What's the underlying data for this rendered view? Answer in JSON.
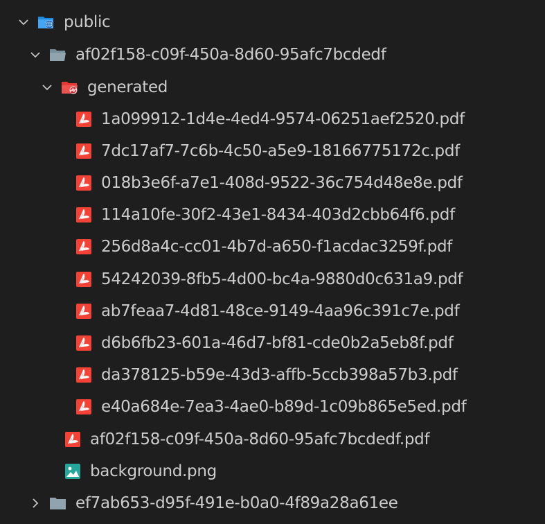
{
  "colors": {
    "background": "#1e1e1e",
    "text": "#cccccc",
    "chevron": "#c5c5c5",
    "folder_public": "#42a5f5",
    "folder_plain": "#90a4ae",
    "folder_generated": "#ef5350",
    "pdf": "#f44336",
    "image": "#26a69a"
  },
  "tree": {
    "public": {
      "label": "public",
      "icon": "folder-public-open-icon",
      "expanded": true
    },
    "folder_af02": {
      "label": "af02f158-c09f-450a-8d60-95afc7bcdedf",
      "icon": "folder-open-icon",
      "expanded": true
    },
    "generated": {
      "label": "generated",
      "icon": "folder-generated-open-icon",
      "expanded": true,
      "files": [
        {
          "label": "1a099912-1d4e-4ed4-9574-06251aef2520.pdf",
          "icon": "pdf-icon"
        },
        {
          "label": "7dc17af7-7c6b-4c50-a5e9-18166775172c.pdf",
          "icon": "pdf-icon"
        },
        {
          "label": "018b3e6f-a7e1-408d-9522-36c754d48e8e.pdf",
          "icon": "pdf-icon"
        },
        {
          "label": "114a10fe-30f2-43e1-8434-403d2cbb64f6.pdf",
          "icon": "pdf-icon"
        },
        {
          "label": "256d8a4c-cc01-4b7d-a650-f1acdac3259f.pdf",
          "icon": "pdf-icon"
        },
        {
          "label": "54242039-8fb5-4d00-bc4a-9880d0c631a9.pdf",
          "icon": "pdf-icon"
        },
        {
          "label": "ab7feaa7-4d81-48ce-9149-4aa96c391c7e.pdf",
          "icon": "pdf-icon"
        },
        {
          "label": "d6b6fb23-601a-46d7-bf81-cde0b2a5eb8f.pdf",
          "icon": "pdf-icon"
        },
        {
          "label": "da378125-b59e-43d3-affb-5ccb398a57b3.pdf",
          "icon": "pdf-icon"
        },
        {
          "label": "e40a684e-7ea3-4ae0-b89d-1c09b865e5ed.pdf",
          "icon": "pdf-icon"
        }
      ]
    },
    "af02_files": [
      {
        "label": "af02f158-c09f-450a-8d60-95afc7bcdedf.pdf",
        "icon": "pdf-icon"
      },
      {
        "label": "background.png",
        "icon": "image-icon"
      }
    ],
    "folder_ef7a": {
      "label": "ef7ab653-d95f-491e-b0a0-4f89a28a61ee",
      "icon": "folder-closed-icon",
      "expanded": false
    }
  }
}
